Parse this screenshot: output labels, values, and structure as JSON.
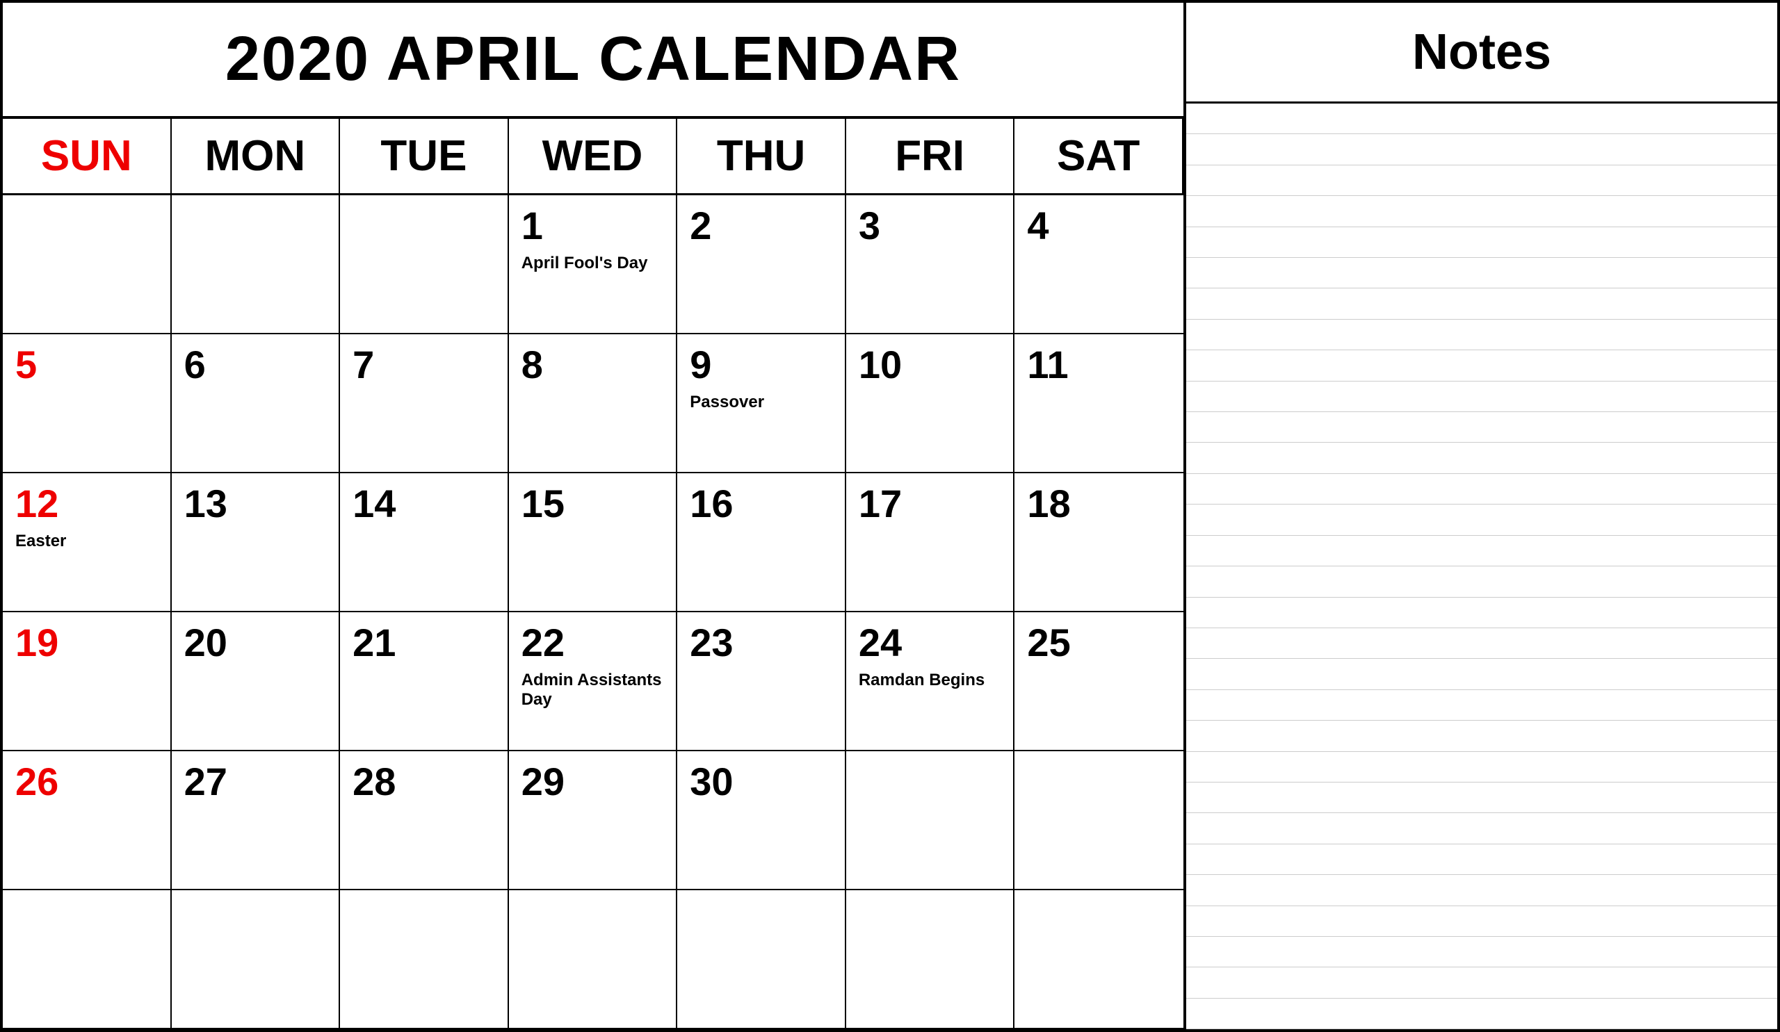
{
  "title": "2020 APRIL CALENDAR",
  "notes_title": "Notes",
  "headers": [
    "SUN",
    "MON",
    "TUE",
    "WED",
    "THU",
    "FRI",
    "SAT"
  ],
  "weeks": [
    [
      {
        "num": "",
        "event": "",
        "sun": false,
        "empty": true
      },
      {
        "num": "",
        "event": "",
        "sun": false,
        "empty": true
      },
      {
        "num": "",
        "event": "",
        "sun": false,
        "empty": true
      },
      {
        "num": "1",
        "event": "April Fool's Day",
        "sun": false,
        "empty": false
      },
      {
        "num": "2",
        "event": "",
        "sun": false,
        "empty": false
      },
      {
        "num": "3",
        "event": "",
        "sun": false,
        "empty": false
      },
      {
        "num": "4",
        "event": "",
        "sun": false,
        "empty": false
      }
    ],
    [
      {
        "num": "5",
        "event": "",
        "sun": true,
        "empty": false
      },
      {
        "num": "6",
        "event": "",
        "sun": false,
        "empty": false
      },
      {
        "num": "7",
        "event": "",
        "sun": false,
        "empty": false
      },
      {
        "num": "8",
        "event": "",
        "sun": false,
        "empty": false
      },
      {
        "num": "9",
        "event": "Passover",
        "sun": false,
        "empty": false
      },
      {
        "num": "10",
        "event": "",
        "sun": false,
        "empty": false
      },
      {
        "num": "11",
        "event": "",
        "sun": false,
        "empty": false
      }
    ],
    [
      {
        "num": "12",
        "event": "Easter",
        "sun": true,
        "empty": false
      },
      {
        "num": "13",
        "event": "",
        "sun": false,
        "empty": false
      },
      {
        "num": "14",
        "event": "",
        "sun": false,
        "empty": false
      },
      {
        "num": "15",
        "event": "",
        "sun": false,
        "empty": false
      },
      {
        "num": "16",
        "event": "",
        "sun": false,
        "empty": false
      },
      {
        "num": "17",
        "event": "",
        "sun": false,
        "empty": false
      },
      {
        "num": "18",
        "event": "",
        "sun": false,
        "empty": false
      }
    ],
    [
      {
        "num": "19",
        "event": "",
        "sun": true,
        "empty": false
      },
      {
        "num": "20",
        "event": "",
        "sun": false,
        "empty": false
      },
      {
        "num": "21",
        "event": "",
        "sun": false,
        "empty": false
      },
      {
        "num": "22",
        "event": "Admin Assistants Day",
        "sun": false,
        "empty": false
      },
      {
        "num": "23",
        "event": "",
        "sun": false,
        "empty": false
      },
      {
        "num": "24",
        "event": "Ramdan Begins",
        "sun": false,
        "empty": false
      },
      {
        "num": "25",
        "event": "",
        "sun": false,
        "empty": false
      }
    ],
    [
      {
        "num": "26",
        "event": "",
        "sun": true,
        "empty": false
      },
      {
        "num": "27",
        "event": "",
        "sun": false,
        "empty": false
      },
      {
        "num": "28",
        "event": "",
        "sun": false,
        "empty": false
      },
      {
        "num": "29",
        "event": "",
        "sun": false,
        "empty": false
      },
      {
        "num": "30",
        "event": "",
        "sun": false,
        "empty": false
      },
      {
        "num": "",
        "event": "",
        "sun": false,
        "empty": true
      },
      {
        "num": "",
        "event": "",
        "sun": false,
        "empty": true
      }
    ],
    [
      {
        "num": "",
        "event": "",
        "sun": false,
        "empty": true
      },
      {
        "num": "",
        "event": "",
        "sun": false,
        "empty": true
      },
      {
        "num": "",
        "event": "",
        "sun": false,
        "empty": true
      },
      {
        "num": "",
        "event": "",
        "sun": false,
        "empty": true
      },
      {
        "num": "",
        "event": "",
        "sun": false,
        "empty": true
      },
      {
        "num": "",
        "event": "",
        "sun": false,
        "empty": true
      },
      {
        "num": "",
        "event": "",
        "sun": false,
        "empty": true
      }
    ]
  ],
  "notes_lines_count": 30
}
